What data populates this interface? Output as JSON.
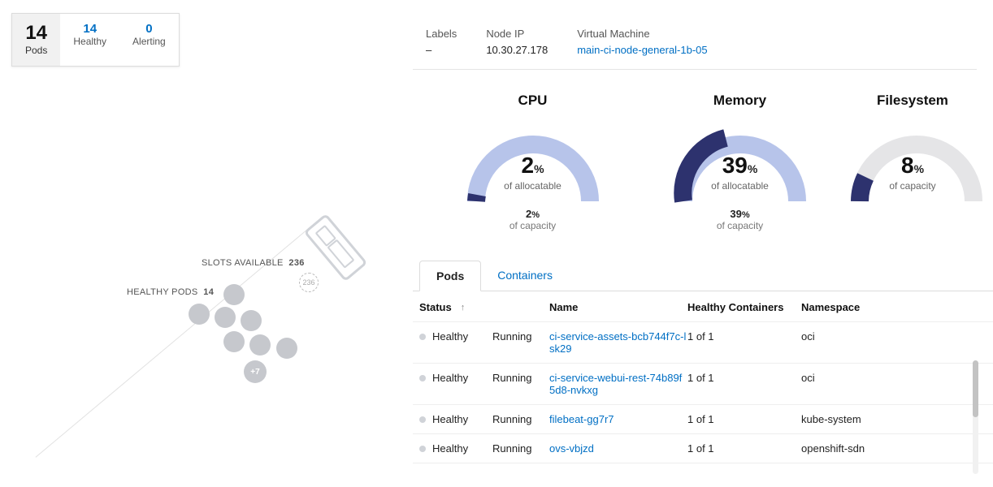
{
  "pods_summary": {
    "total": "14",
    "total_label": "Pods",
    "healthy": "14",
    "healthy_label": "Healthy",
    "alerting": "0",
    "alerting_label": "Alerting"
  },
  "hex": {
    "slots_label": "SLOTS AVAILABLE",
    "slots_value": "236",
    "slots_badge": "236",
    "healthy_label": "HEALTHY PODS",
    "healthy_value": "14",
    "more_badge": "+7"
  },
  "meta": {
    "labels_k": "Labels",
    "labels_v": "–",
    "nodeip_k": "Node IP",
    "nodeip_v": "10.30.27.178",
    "vm_k": "Virtual Machine",
    "vm_v": "main-ci-node-general-1b-05"
  },
  "chart_data": [
    {
      "type": "gauge",
      "title": "CPU",
      "value_pct": 2,
      "value_label": "of allocatable",
      "capacity_pct": 2,
      "capacity_label": "of capacity",
      "fg": "#2d326e",
      "bg": "#b7c4ea"
    },
    {
      "type": "gauge",
      "title": "Memory",
      "value_pct": 39,
      "value_label": "of allocatable",
      "capacity_pct": 39,
      "capacity_label": "of capacity",
      "fg": "#2d326e",
      "bg": "#b7c4ea"
    },
    {
      "type": "gauge",
      "title": "Filesystem",
      "value_pct": 8,
      "value_label": "of capacity",
      "capacity_pct": null,
      "capacity_label": "",
      "fg": "#2d326e",
      "bg": "#e5e5e7"
    }
  ],
  "tabs": {
    "pods": "Pods",
    "containers": "Containers"
  },
  "table": {
    "headers": {
      "status": "Status",
      "name": "Name",
      "healthy_containers": "Healthy Containers",
      "namespace": "Namespace"
    },
    "rows": [
      {
        "status": "Healthy",
        "state": "Running",
        "name": "ci-service-assets-bcb744f7c-lsk29",
        "hc": "1 of 1",
        "ns": "oci"
      },
      {
        "status": "Healthy",
        "state": "Running",
        "name": "ci-service-webui-rest-74b89f5d8-nvkxg",
        "hc": "1 of 1",
        "ns": "oci"
      },
      {
        "status": "Healthy",
        "state": "Running",
        "name": "filebeat-gg7r7",
        "hc": "1 of 1",
        "ns": "kube-system"
      },
      {
        "status": "Healthy",
        "state": "Running",
        "name": "ovs-vbjzd",
        "hc": "1 of 1",
        "ns": "openshift-sdn"
      }
    ]
  }
}
